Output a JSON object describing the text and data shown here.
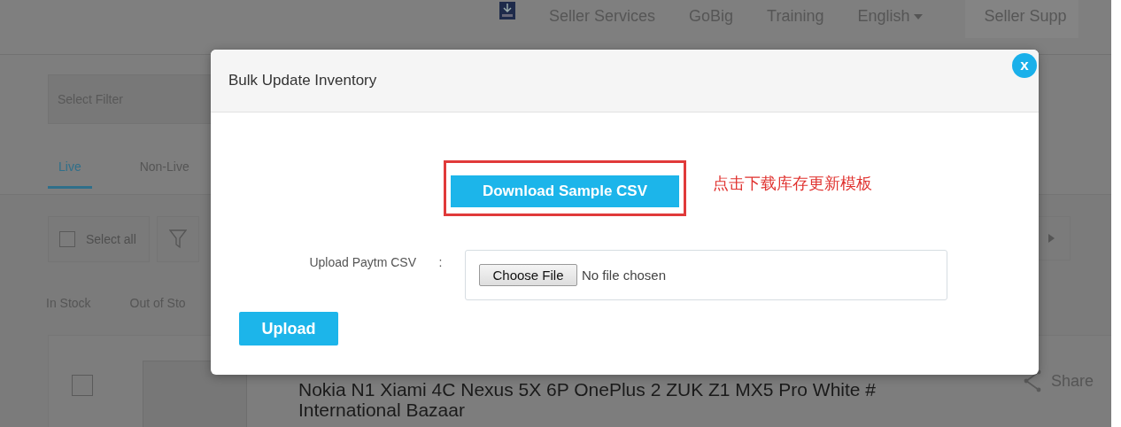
{
  "header": {
    "nav": [
      {
        "label": "Seller Services",
        "kind": "link"
      },
      {
        "label": "GoBig",
        "kind": "link"
      },
      {
        "label": "Training",
        "kind": "link"
      },
      {
        "label": "English",
        "kind": "dropdown"
      },
      {
        "label": "Seller Supp",
        "kind": "box"
      }
    ]
  },
  "filter": {
    "placeholder": "Select Filter"
  },
  "tabs": [
    {
      "label": "Live",
      "selected": true
    },
    {
      "label": "Non-Live",
      "selected": false
    }
  ],
  "select_all": {
    "label": "Select all",
    "checked": false
  },
  "stock_tabs": [
    {
      "label": "In Stock",
      "selected": false
    },
    {
      "label": "Out of Sto",
      "selected": false
    }
  ],
  "product": {
    "checked": false,
    "title_lines": [
      "Nokia N1 Xiami 4C Nexus 5X 6P OnePlus 2 ZUK Z1 MX5 Pro White #",
      "International Bazaar"
    ],
    "share": "Share"
  },
  "modal": {
    "title": "Bulk Update Inventory",
    "close": "x",
    "download_button": "Download Sample CSV",
    "annotation": "点击下载库存更新模板",
    "upload_label": "Upload Paytm CSV",
    "separator": ":",
    "file_button": "Choose File",
    "file_status": "No file chosen",
    "upload_button": "Upload"
  }
}
